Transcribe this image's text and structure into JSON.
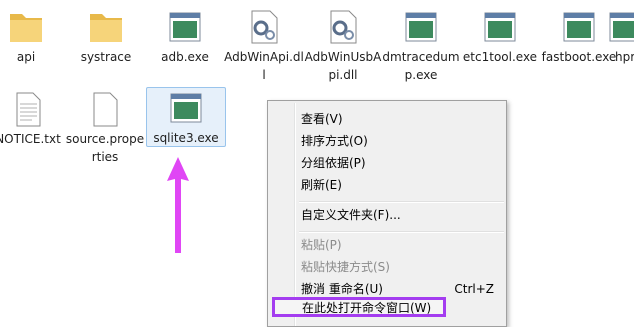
{
  "files": [
    {
      "name": "api",
      "type": "folder-icon"
    },
    {
      "name": "systrace",
      "type": "folder-icon"
    },
    {
      "name": "adb.exe",
      "type": "exe-icon"
    },
    {
      "name": "AdbWinApi.dll",
      "type": "dll-icon"
    },
    {
      "name": "AdbWinUsbApi.dll",
      "type": "dll-icon"
    },
    {
      "name": "dmtracedump.exe",
      "type": "exe-icon"
    },
    {
      "name": "etc1tool.exe",
      "type": "exe-icon"
    },
    {
      "name": "fastboot.exe",
      "type": "exe-icon"
    },
    {
      "name": "hprof",
      "type": "exe-icon"
    },
    {
      "name": "NOTICE.txt",
      "type": "document-icon"
    },
    {
      "name": "source.properties",
      "type": "document-icon"
    },
    {
      "name": "sqlite3.exe",
      "type": "exe-icon"
    }
  ],
  "context_menu": {
    "items": [
      {
        "label": "查看(V)",
        "disabled": false
      },
      {
        "label": "排序方式(O)",
        "disabled": false
      },
      {
        "label": "分组依据(P)",
        "disabled": false
      },
      {
        "label": "刷新(E)",
        "disabled": false
      },
      {
        "label": "自定义文件夹(F)...",
        "disabled": false
      },
      {
        "label": "粘贴(P)",
        "disabled": true
      },
      {
        "label": "粘贴快捷方式(S)",
        "disabled": true
      },
      {
        "label": "撤消 重命名(U)",
        "shortcut": "Ctrl+Z",
        "disabled": false
      },
      {
        "label": "在此处打开命令窗口(W)",
        "disabled": false
      }
    ]
  },
  "colors": {
    "highlight_border": "#a43df0",
    "arrow": "#e046f5",
    "folder": "#f2cf6b"
  }
}
